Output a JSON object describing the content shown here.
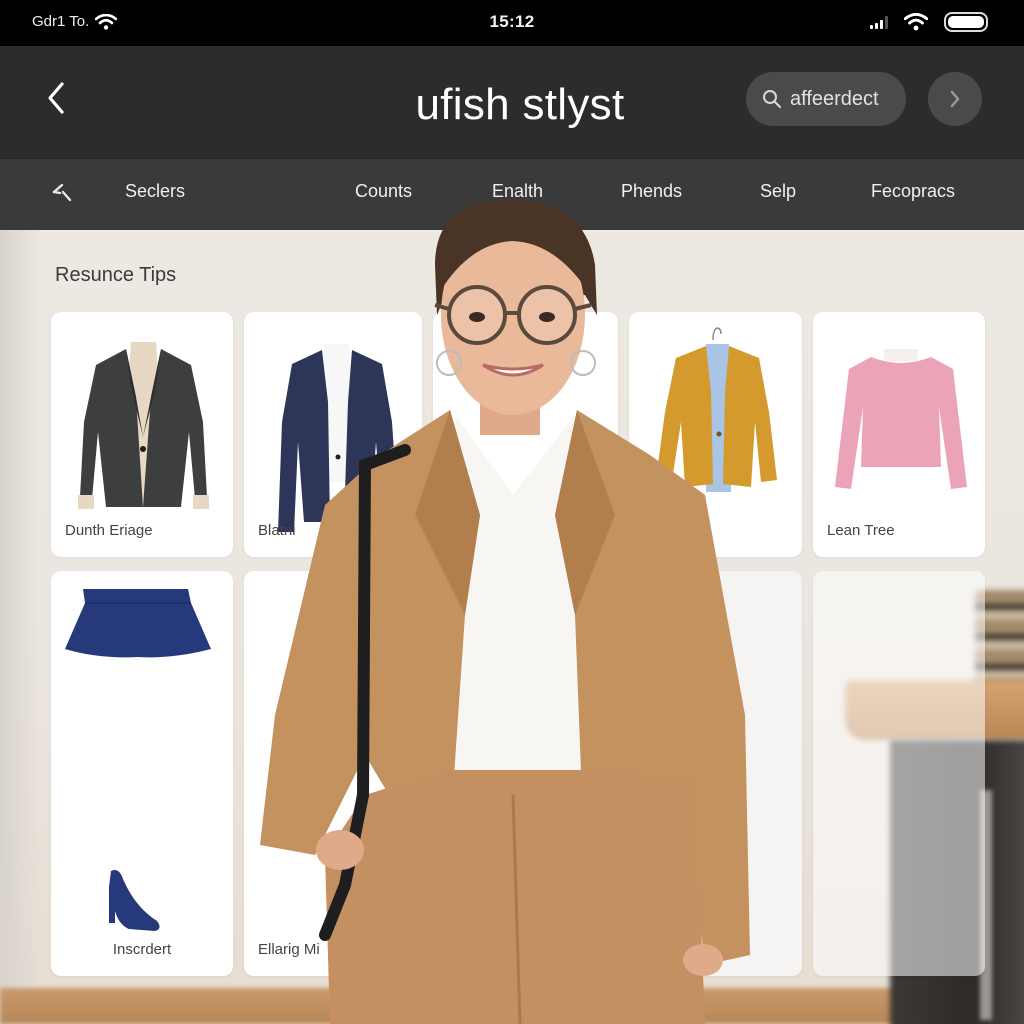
{
  "status_bar": {
    "carrier": "Gdr1 To.",
    "time": "15:12",
    "icons": [
      "wifi-icon",
      "signal-icon",
      "wifi-icon",
      "battery-icon"
    ]
  },
  "header": {
    "back_icon": "chevron-left-icon",
    "title": "ufish stlyst",
    "search": {
      "icon": "search-icon",
      "value": "affeerdect"
    },
    "next_icon": "chevron-right-icon"
  },
  "nav": {
    "icon": "magic-wand-icon",
    "items": [
      {
        "label": "Seclers"
      },
      {
        "label": "Counts"
      },
      {
        "label": "Enalth"
      },
      {
        "label": "Phends"
      },
      {
        "label": "Selp"
      },
      {
        "label": "Fecopracs"
      }
    ]
  },
  "section": {
    "title": "Resunce Tips"
  },
  "cards": [
    {
      "label": "Dunth Eriage",
      "image": "charcoal-blazer",
      "colors": {
        "primary": "#3d3f3e",
        "secondary": "#e6d8c2"
      }
    },
    {
      "label": "Blatni",
      "image": "navy-blazer",
      "colors": {
        "primary": "#2d3658",
        "secondary": "#f7f7f7"
      }
    },
    {
      "label": "",
      "image": "blank"
    },
    {
      "label": "",
      "image": "mustard-blazer",
      "colors": {
        "primary": "#d49a2e",
        "secondary": "#a9c4e4"
      }
    },
    {
      "label": "Lean Tree",
      "image": "pink-sweater",
      "colors": {
        "primary": "#eba3b7",
        "secondary": "#f5f1ea"
      }
    },
    {
      "label": "Inscrdert",
      "image": "navy-skirt-and-pump",
      "colors": {
        "primary": "#26397a"
      }
    },
    {
      "label": "Ellarig Mi",
      "image": "blank"
    },
    {
      "label": "",
      "image": "blank"
    },
    {
      "label": "",
      "image": "blank"
    }
  ],
  "model": {
    "description": "woman in camel suit with white shirt and glasses",
    "colors": {
      "suit": "#c4925f",
      "shirt": "#f8f6f2",
      "hair": "#4a3426",
      "skin": "#e9b99a"
    }
  }
}
